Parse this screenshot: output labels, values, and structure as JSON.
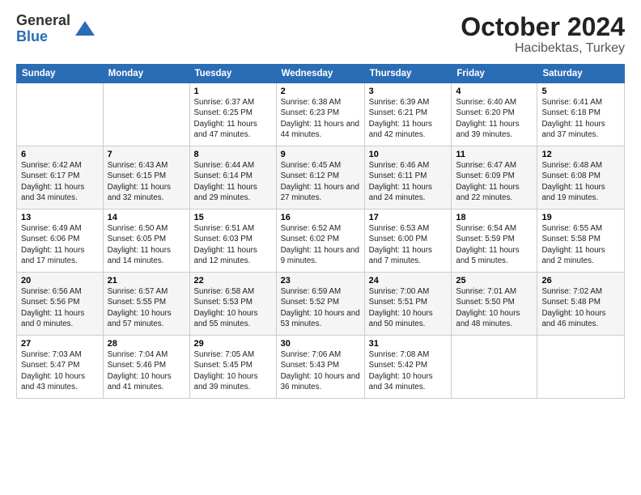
{
  "logo": {
    "general": "General",
    "blue": "Blue"
  },
  "title": {
    "month": "October 2024",
    "location": "Hacibektas, Turkey"
  },
  "weekdays": [
    "Sunday",
    "Monday",
    "Tuesday",
    "Wednesday",
    "Thursday",
    "Friday",
    "Saturday"
  ],
  "weeks": [
    [
      null,
      null,
      {
        "day": "1",
        "sunrise": "6:37 AM",
        "sunset": "6:25 PM",
        "daylight": "11 hours and 47 minutes."
      },
      {
        "day": "2",
        "sunrise": "6:38 AM",
        "sunset": "6:23 PM",
        "daylight": "11 hours and 44 minutes."
      },
      {
        "day": "3",
        "sunrise": "6:39 AM",
        "sunset": "6:21 PM",
        "daylight": "11 hours and 42 minutes."
      },
      {
        "day": "4",
        "sunrise": "6:40 AM",
        "sunset": "6:20 PM",
        "daylight": "11 hours and 39 minutes."
      },
      {
        "day": "5",
        "sunrise": "6:41 AM",
        "sunset": "6:18 PM",
        "daylight": "11 hours and 37 minutes."
      }
    ],
    [
      {
        "day": "6",
        "sunrise": "6:42 AM",
        "sunset": "6:17 PM",
        "daylight": "11 hours and 34 minutes."
      },
      {
        "day": "7",
        "sunrise": "6:43 AM",
        "sunset": "6:15 PM",
        "daylight": "11 hours and 32 minutes."
      },
      {
        "day": "8",
        "sunrise": "6:44 AM",
        "sunset": "6:14 PM",
        "daylight": "11 hours and 29 minutes."
      },
      {
        "day": "9",
        "sunrise": "6:45 AM",
        "sunset": "6:12 PM",
        "daylight": "11 hours and 27 minutes."
      },
      {
        "day": "10",
        "sunrise": "6:46 AM",
        "sunset": "6:11 PM",
        "daylight": "11 hours and 24 minutes."
      },
      {
        "day": "11",
        "sunrise": "6:47 AM",
        "sunset": "6:09 PM",
        "daylight": "11 hours and 22 minutes."
      },
      {
        "day": "12",
        "sunrise": "6:48 AM",
        "sunset": "6:08 PM",
        "daylight": "11 hours and 19 minutes."
      }
    ],
    [
      {
        "day": "13",
        "sunrise": "6:49 AM",
        "sunset": "6:06 PM",
        "daylight": "11 hours and 17 minutes."
      },
      {
        "day": "14",
        "sunrise": "6:50 AM",
        "sunset": "6:05 PM",
        "daylight": "11 hours and 14 minutes."
      },
      {
        "day": "15",
        "sunrise": "6:51 AM",
        "sunset": "6:03 PM",
        "daylight": "11 hours and 12 minutes."
      },
      {
        "day": "16",
        "sunrise": "6:52 AM",
        "sunset": "6:02 PM",
        "daylight": "11 hours and 9 minutes."
      },
      {
        "day": "17",
        "sunrise": "6:53 AM",
        "sunset": "6:00 PM",
        "daylight": "11 hours and 7 minutes."
      },
      {
        "day": "18",
        "sunrise": "6:54 AM",
        "sunset": "5:59 PM",
        "daylight": "11 hours and 5 minutes."
      },
      {
        "day": "19",
        "sunrise": "6:55 AM",
        "sunset": "5:58 PM",
        "daylight": "11 hours and 2 minutes."
      }
    ],
    [
      {
        "day": "20",
        "sunrise": "6:56 AM",
        "sunset": "5:56 PM",
        "daylight": "11 hours and 0 minutes."
      },
      {
        "day": "21",
        "sunrise": "6:57 AM",
        "sunset": "5:55 PM",
        "daylight": "10 hours and 57 minutes."
      },
      {
        "day": "22",
        "sunrise": "6:58 AM",
        "sunset": "5:53 PM",
        "daylight": "10 hours and 55 minutes."
      },
      {
        "day": "23",
        "sunrise": "6:59 AM",
        "sunset": "5:52 PM",
        "daylight": "10 hours and 53 minutes."
      },
      {
        "day": "24",
        "sunrise": "7:00 AM",
        "sunset": "5:51 PM",
        "daylight": "10 hours and 50 minutes."
      },
      {
        "day": "25",
        "sunrise": "7:01 AM",
        "sunset": "5:50 PM",
        "daylight": "10 hours and 48 minutes."
      },
      {
        "day": "26",
        "sunrise": "7:02 AM",
        "sunset": "5:48 PM",
        "daylight": "10 hours and 46 minutes."
      }
    ],
    [
      {
        "day": "27",
        "sunrise": "7:03 AM",
        "sunset": "5:47 PM",
        "daylight": "10 hours and 43 minutes."
      },
      {
        "day": "28",
        "sunrise": "7:04 AM",
        "sunset": "5:46 PM",
        "daylight": "10 hours and 41 minutes."
      },
      {
        "day": "29",
        "sunrise": "7:05 AM",
        "sunset": "5:45 PM",
        "daylight": "10 hours and 39 minutes."
      },
      {
        "day": "30",
        "sunrise": "7:06 AM",
        "sunset": "5:43 PM",
        "daylight": "10 hours and 36 minutes."
      },
      {
        "day": "31",
        "sunrise": "7:08 AM",
        "sunset": "5:42 PM",
        "daylight": "10 hours and 34 minutes."
      },
      null,
      null
    ]
  ]
}
